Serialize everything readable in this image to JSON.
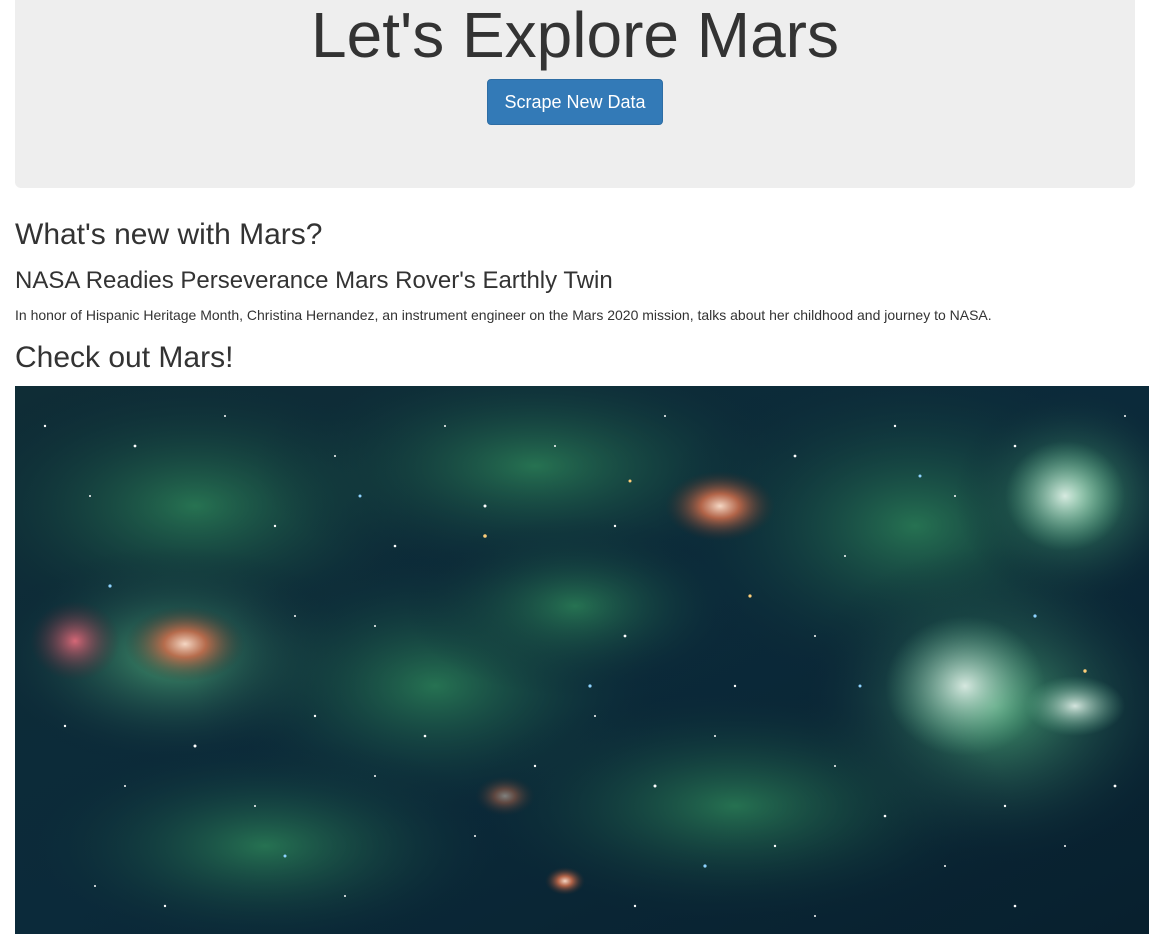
{
  "jumbotron": {
    "title": "Let's Explore Mars",
    "button_label": "Scrape New Data"
  },
  "news": {
    "section_heading": "What's new with Mars?",
    "title": "NASA Readies Perseverance Mars Rover's Earthly Twin",
    "paragraph": "In honor of Hispanic Heritage Month, Christina Hernandez, an instrument engineer on the Mars 2020 mission, talks about her childhood and journey to NASA."
  },
  "featured": {
    "section_heading": "Check out Mars!",
    "image_icon": "nebula-image"
  }
}
